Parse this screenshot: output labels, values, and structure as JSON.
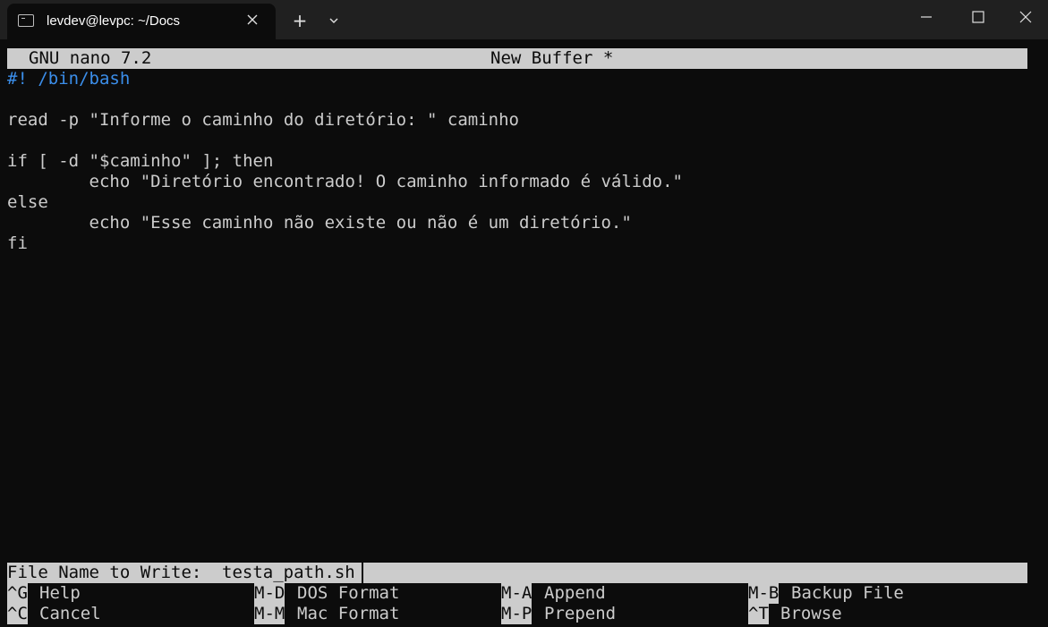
{
  "window": {
    "tab_title": "levdev@levpc: ~/Docs",
    "new_tab_label": "+"
  },
  "nano": {
    "version_label": "GNU nano 7.2",
    "buffer_label": "New Buffer *"
  },
  "code": [
    "#! /bin/bash",
    "",
    "read -p \"Informe o caminho do diretório: \" caminho",
    "",
    "if [ -d \"$caminho\" ]; then",
    "        echo \"Diretório encontrado! O caminho informado é válido.\"",
    "else",
    "        echo \"Esse caminho não existe ou não é um diretório.\"",
    "fi"
  ],
  "prompt": {
    "label": "File Name to Write: ",
    "value": "testa_path.sh"
  },
  "shortcuts": [
    {
      "key": "^G",
      "label": "Help"
    },
    {
      "key": "M-D",
      "label": "DOS Format"
    },
    {
      "key": "M-A",
      "label": "Append"
    },
    {
      "key": "M-B",
      "label": "Backup File"
    },
    {
      "key": "^C",
      "label": "Cancel"
    },
    {
      "key": "M-M",
      "label": "Mac Format"
    },
    {
      "key": "M-P",
      "label": "Prepend"
    },
    {
      "key": "^T",
      "label": "Browse"
    }
  ],
  "colors": {
    "background": "#0c0c0c",
    "foreground": "#cccccc",
    "shebang": "#3b8eea",
    "titlebar": "#202020"
  },
  "icons": {
    "tab_icon": "terminal-icon",
    "tab_close": "close-icon",
    "dropdown": "chevron-down-icon",
    "minimize": "minimize-icon",
    "maximize": "maximize-icon",
    "close": "close-icon"
  }
}
